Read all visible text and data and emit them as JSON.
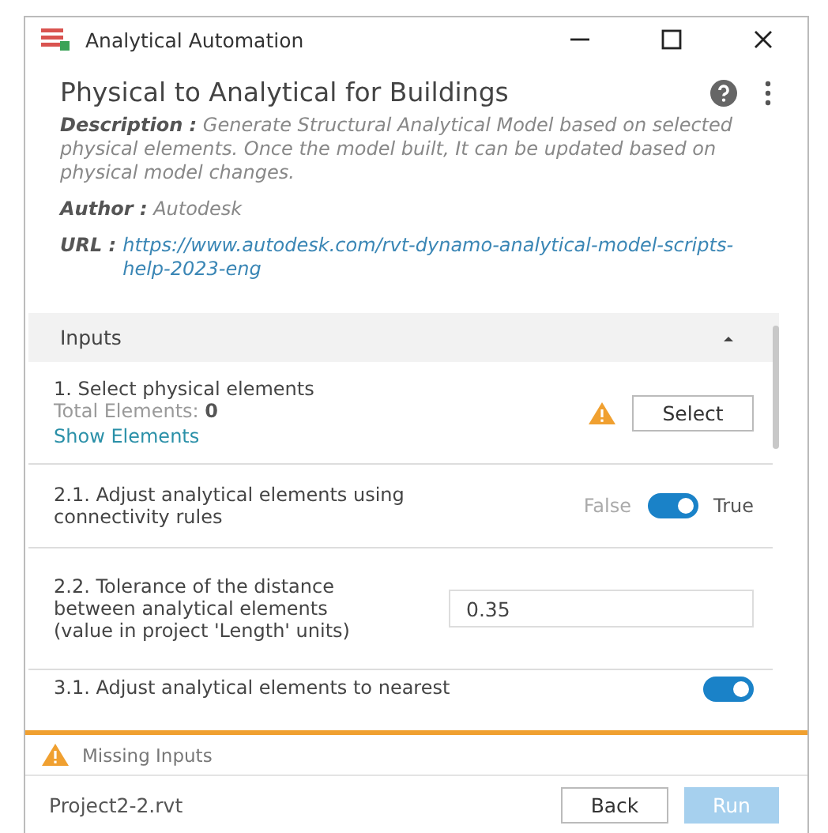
{
  "window": {
    "title": "Analytical Automation"
  },
  "heading": "Physical to Analytical for Buildings",
  "description": {
    "label": "Description :",
    "text": "Generate Structural Analytical Model based on selected physical elements. Once the model built, It can be updated based on physical model changes."
  },
  "author": {
    "label": "Author :",
    "text": "Autodesk"
  },
  "url": {
    "label": "URL :",
    "link": "https://www.autodesk.com/rvt-dynamo-analytical-model-scripts-help-2023-eng"
  },
  "inputs": {
    "title": "Inputs",
    "expanded": true,
    "items": [
      {
        "kind": "select",
        "label": "1. Select physical elements",
        "count_label": "Total Elements:",
        "count": "0",
        "link": "Show Elements",
        "warning": true,
        "button": "Select"
      },
      {
        "kind": "toggle",
        "label": "2.1. Adjust analytical elements using connectivity rules",
        "off_label": "False",
        "on_label": "True",
        "on": true
      },
      {
        "kind": "number",
        "label": "2.2. Tolerance of the distance between analytical elements (value in project 'Length' units)",
        "value": "0.35"
      },
      {
        "kind": "toggle",
        "label": "3.1. Adjust analytical elements to nearest",
        "on": true
      }
    ]
  },
  "status": {
    "warning": true,
    "text": "Missing Inputs"
  },
  "footer": {
    "file": "Project2-2.rvt",
    "back": "Back",
    "run": "Run",
    "run_disabled": true
  }
}
